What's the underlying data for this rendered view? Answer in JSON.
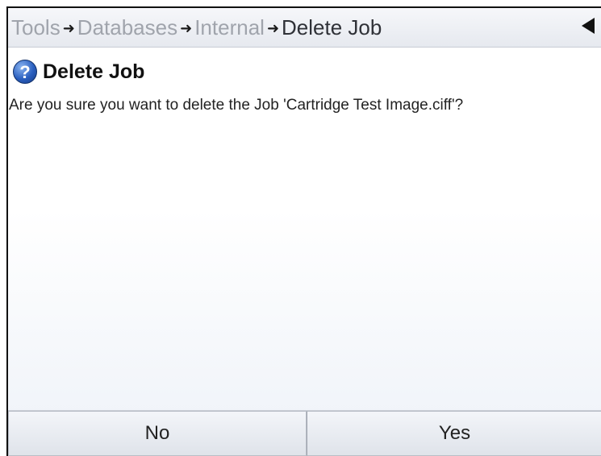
{
  "breadcrumb": {
    "items": [
      "Tools",
      "Databases",
      "Internal",
      "Delete Job"
    ]
  },
  "dialog": {
    "title": "Delete Job",
    "message": "Are you sure you want to delete the Job 'Cartridge Test Image.ciff'?"
  },
  "buttons": {
    "no_label": "No",
    "yes_label": "Yes"
  },
  "icons": {
    "question": "question-icon",
    "back": "back-arrow-icon",
    "separator": "right-arrow-icon"
  },
  "colors": {
    "icon_blue": "#2a5fbf",
    "text": "#222222",
    "crumb_inactive": "#a0a4ac"
  }
}
